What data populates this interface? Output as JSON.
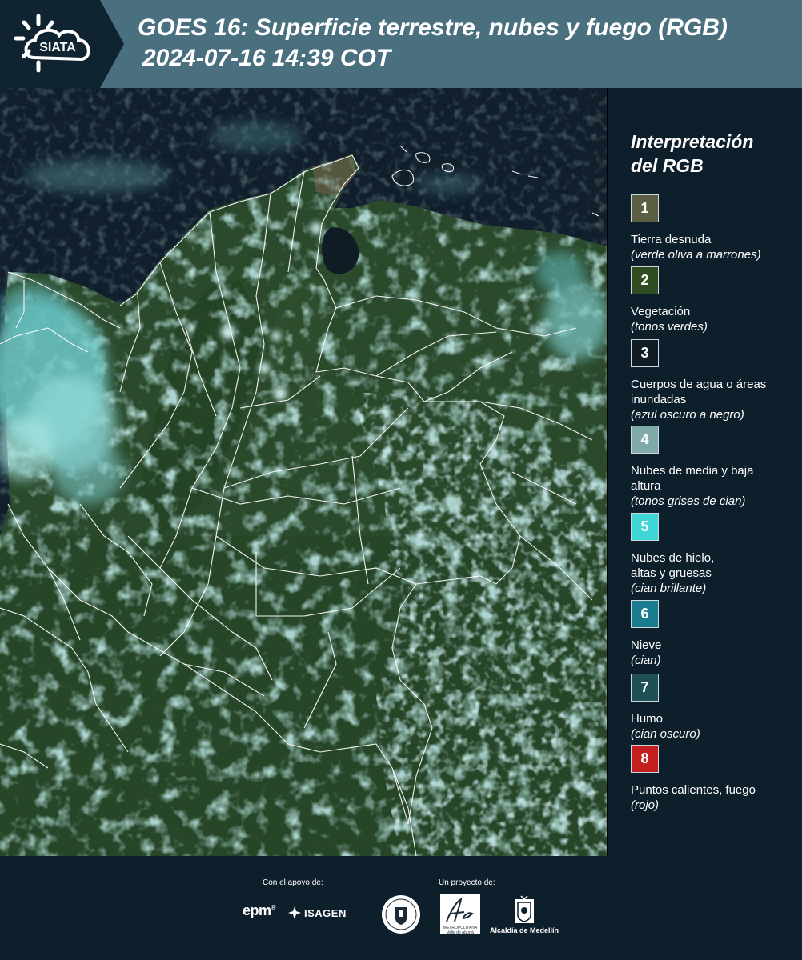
{
  "header": {
    "logo_text": "SIATA",
    "title_line1": "GOES 16: Superficie terrestre, nubes y fuego (RGB)",
    "title_line2": "2024-07-16 14:39 COT"
  },
  "colors": {
    "header_bg": "#4a7080",
    "logo_bg": "#0f2330",
    "panel_bg": "#0d1f2b"
  },
  "legend": {
    "title_line1": "Interpretación",
    "title_line2": "del RGB",
    "items": [
      {
        "number": "1",
        "label": "Tierra desnuda",
        "sublabel": "(verde oliva a marrones)",
        "color": "#5c5e43"
      },
      {
        "number": "2",
        "label": "Vegetación",
        "sublabel": "(tonos verdes)",
        "color": "#2f4d22"
      },
      {
        "number": "3",
        "label": "Cuerpos de agua o áreas inundadas",
        "sublabel": "(azul oscuro a negro)",
        "color": "#0f1c24"
      },
      {
        "number": "4",
        "label": "Nubes de media y baja altura",
        "sublabel": "(tonos grises de cian)",
        "color": "#7faaa9"
      },
      {
        "number": "5",
        "label": "Nubes de hielo, altas y gruesas",
        "sublabel": "(cian brillante)",
        "color": "#3fd6d8"
      },
      {
        "number": "6",
        "label": "Nieve",
        "sublabel": "(cian)",
        "color": "#1a7d8f"
      },
      {
        "number": "7",
        "label": "Humo",
        "sublabel": "(cian oscuro)",
        "color": "#1f5055"
      },
      {
        "number": "8",
        "label": "Puntos calientes, fuego",
        "sublabel": "(rojo)",
        "color": "#c41f1f"
      }
    ]
  },
  "footer": {
    "support_label": "Con el apoyo de:",
    "project_label": "Un proyecto de:",
    "sponsor_epm": "epm",
    "sponsor_isagen": "ISAGEN",
    "metro_caption": "METROPOLITANA Valle de Aburrá",
    "alcaldia": "Alcaldía de Medellín"
  }
}
